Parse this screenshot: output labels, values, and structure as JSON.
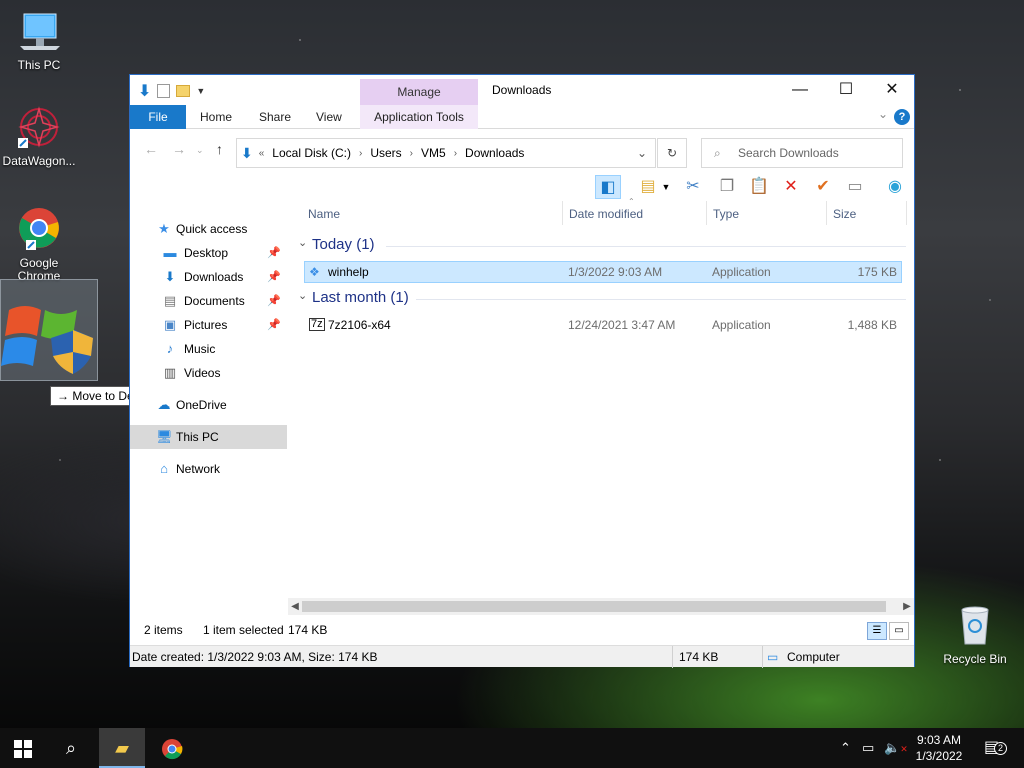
{
  "desktop": {
    "icons": [
      {
        "label": "This PC",
        "icon": "this-pc-icon"
      },
      {
        "label": "DataWagon...",
        "icon": "datawagon-icon"
      },
      {
        "label": "Google Chrome",
        "icon": "chrome-icon"
      },
      {
        "label": "Recycle Bin",
        "icon": "recycle-bin-icon"
      }
    ],
    "drag_tooltip": "Move to Desktop"
  },
  "window": {
    "title": "Downloads",
    "manage_tab": "Manage",
    "ribbon_tabs": {
      "file": "File",
      "home": "Home",
      "share": "Share",
      "view": "View",
      "app_tools": "Application Tools"
    },
    "address": {
      "overflow": "«",
      "crumbs": [
        "Local Disk (C:)",
        "Users",
        "VM5",
        "Downloads"
      ]
    },
    "search_placeholder": "Search Downloads",
    "nav": {
      "quick_access": "Quick access",
      "desktop": "Desktop",
      "downloads": "Downloads",
      "documents": "Documents",
      "pictures": "Pictures",
      "music": "Music",
      "videos": "Videos",
      "onedrive": "OneDrive",
      "this_pc": "This PC",
      "network": "Network"
    },
    "columns": {
      "name": "Name",
      "date": "Date modified",
      "type": "Type",
      "size": "Size"
    },
    "groups": [
      {
        "header": "Today (1)",
        "files": [
          {
            "name": "winhelp",
            "date": "1/3/2022 9:03 AM",
            "type": "Application",
            "size": "175 KB"
          }
        ]
      },
      {
        "header": "Last month (1)",
        "files": [
          {
            "name": "7z2106-x64",
            "date": "12/24/2021 3:47 AM",
            "type": "Application",
            "size": "1,488 KB"
          }
        ]
      }
    ],
    "status": {
      "items": "2 items",
      "selected": "1 item selected",
      "selected_size": "174 KB"
    },
    "details": {
      "text": "Date created: 1/3/2022 9:03 AM, Size: 174 KB",
      "size": "174 KB",
      "location": "Computer"
    }
  },
  "taskbar": {
    "time": "9:03 AM",
    "date": "1/3/2022",
    "notification_count": "2"
  }
}
